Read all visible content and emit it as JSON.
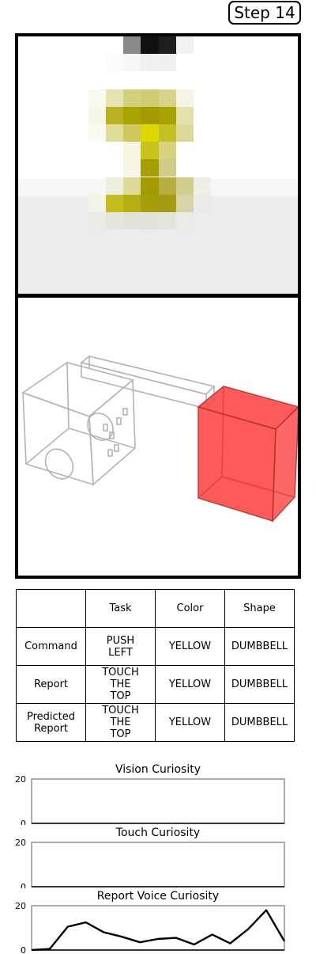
{
  "step_label": "Step 14",
  "table": {
    "headers": [
      "",
      "Task",
      "Color",
      "Shape"
    ],
    "rows": [
      [
        "Command",
        "PUSH\nLEFT",
        "YELLOW",
        "DUMBBELL"
      ],
      [
        "Report",
        "TOUCH\nTHE\nTOP",
        "YELLOW",
        "DUMBBELL"
      ],
      [
        "Predicted\nReport",
        "TOUCH\nTHE\nTOP",
        "YELLOW",
        "DUMBBELL"
      ]
    ]
  },
  "colors": {
    "target_object": "#ff4d4d",
    "dumbbell_yellow": "#a8a000"
  },
  "chart_data": [
    {
      "type": "line",
      "title": "Vision Curiosity",
      "ylim": [
        0,
        20
      ],
      "yticks": [
        0,
        20
      ],
      "x": [],
      "values": []
    },
    {
      "type": "line",
      "title": "Touch Curiosity",
      "ylim": [
        0,
        20
      ],
      "yticks": [
        0,
        20
      ],
      "x": [],
      "values": []
    },
    {
      "type": "line",
      "title": "Report Voice Curiosity",
      "ylim": [
        0,
        20
      ],
      "yticks": [
        0,
        20
      ],
      "x": [
        0,
        1,
        2,
        3,
        4,
        5,
        6,
        7,
        8,
        9,
        10,
        11,
        12,
        13,
        14
      ],
      "values": [
        0,
        0.5,
        10.5,
        12.5,
        8,
        6,
        3.5,
        5,
        5.5,
        2.5,
        7,
        3,
        9.5,
        18,
        4
      ]
    }
  ]
}
